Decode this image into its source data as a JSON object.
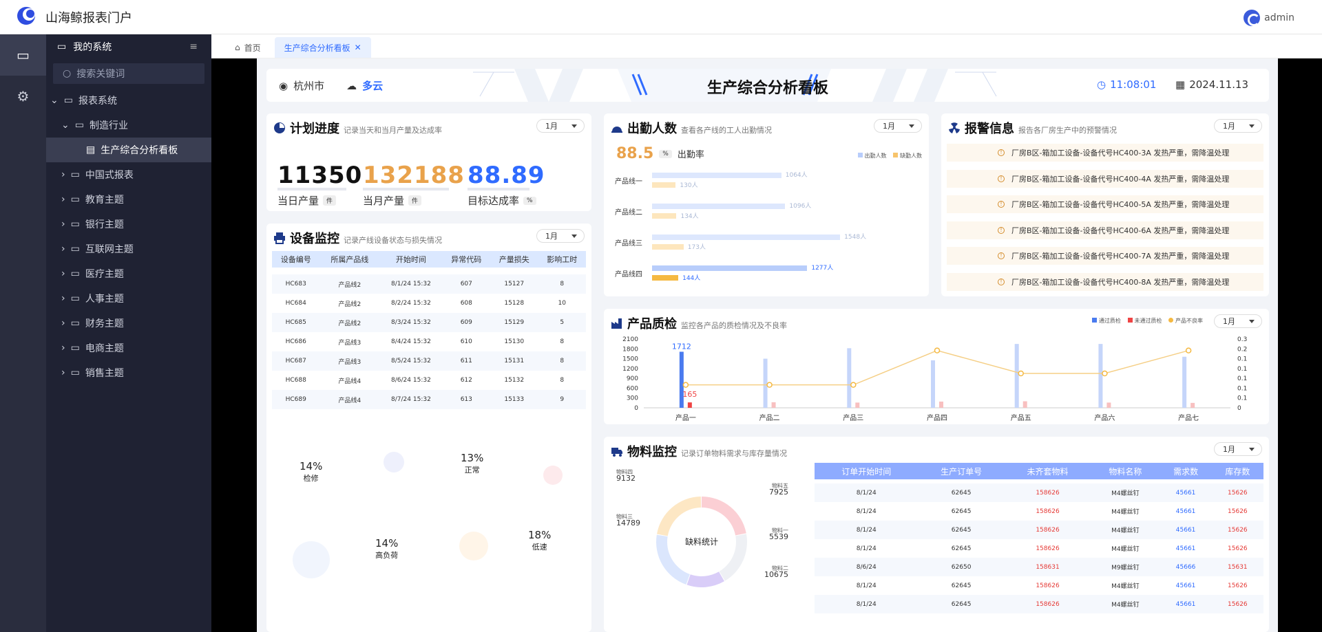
{
  "app": {
    "title": "山海鲸报表门户",
    "user": "admin"
  },
  "sidebar": {
    "header": "我的系统",
    "search_placeholder": "搜索关键词",
    "root": "报表系统",
    "group": "制造行业",
    "active": "生产综合分析看板",
    "items": [
      "中国式报表",
      "教育主题",
      "银行主题",
      "互联网主题",
      "医疗主题",
      "人事主题",
      "财务主题",
      "电商主题",
      "销售主题"
    ]
  },
  "tabs": {
    "home": "首页",
    "current": "生产综合分析看板"
  },
  "header": {
    "city": "杭州市",
    "weather": "多云",
    "title": "生产综合分析看板",
    "time": "11:08:01",
    "date": "2024.11.13"
  },
  "month": "1月",
  "plan": {
    "title": "计划进度",
    "desc": "记录当天和当月产量及达成率",
    "daily": "11350",
    "daily_label": "当日产量",
    "daily_unit": "件",
    "monthly": "132188",
    "monthly_label": "当月产量",
    "monthly_unit": "件",
    "rate": "88.89",
    "rate_label": "目标达成率",
    "rate_unit": "%"
  },
  "attendance": {
    "title": "出勤人数",
    "desc": "查看各产线的工人出勤情况",
    "rate": "88.5",
    "rate_unit": "%",
    "rate_label": "出勤率",
    "legend": [
      "出勤人数",
      "缺勤人数"
    ],
    "lines": [
      {
        "name": "产品线一",
        "present": 1064,
        "absent": 130,
        "present_label": "1064人",
        "absent_label": "130人"
      },
      {
        "name": "产品线二",
        "present": 1096,
        "absent": 134,
        "present_label": "1096人",
        "absent_label": "134人"
      },
      {
        "name": "产品线三",
        "present": 1548,
        "absent": 173,
        "present_label": "1548人",
        "absent_label": "173人"
      },
      {
        "name": "产品线四",
        "present": 1277,
        "absent": 144,
        "present_label": "1277人",
        "absent_label": "144人"
      }
    ]
  },
  "alerts": {
    "title": "报警信息",
    "desc": "报告各厂房生产中的预警情况",
    "items": [
      "厂房B区-箱加工设备-设备代号HC400-3A 发热严重，需降温处理",
      "厂房B区-箱加工设备-设备代号HC400-4A 发热严重，需降温处理",
      "厂房B区-箱加工设备-设备代号HC400-5A 发热严重，需降温处理",
      "厂房B区-箱加工设备-设备代号HC400-6A 发热严重，需降温处理",
      "厂房B区-箱加工设备-设备代号HC400-7A 发热严重，需降温处理",
      "厂房B区-箱加工设备-设备代号HC400-8A 发热严重，需降温处理"
    ]
  },
  "device": {
    "title": "设备监控",
    "desc": "记录产线设备状态与损失情况",
    "columns": [
      "设备编号",
      "所属产品线",
      "开始时间",
      "异常代码",
      "产量损失",
      "影响工时"
    ],
    "rows": [
      [
        "HC683",
        "产品线2",
        "8/1/24 15:32",
        "607",
        "15127",
        "8"
      ],
      [
        "HC684",
        "产品线2",
        "8/2/24 15:32",
        "608",
        "15128",
        "10"
      ],
      [
        "HC685",
        "产品线2",
        "8/3/24 15:32",
        "609",
        "15129",
        "5"
      ],
      [
        "HC686",
        "产品线3",
        "8/4/24 15:32",
        "610",
        "15130",
        "8"
      ],
      [
        "HC687",
        "产品线3",
        "8/5/24 15:32",
        "611",
        "15131",
        "8"
      ],
      [
        "HC688",
        "产品线4",
        "8/6/24 15:32",
        "612",
        "15132",
        "8"
      ],
      [
        "HC689",
        "产品线4",
        "8/7/24 15:32",
        "613",
        "15133",
        "9"
      ]
    ],
    "status": [
      {
        "pct": "14%",
        "label": "检修"
      },
      {
        "pct": "13%",
        "label": "正常"
      },
      {
        "pct": "14%",
        "label": "高负荷"
      },
      {
        "pct": "18%",
        "label": "低速"
      }
    ]
  },
  "quality": {
    "title": "产品质检",
    "desc": "监控各产品的质检情况及不良率",
    "legend": [
      "通过质检",
      "未通过质检",
      "产品不良率"
    ],
    "annotations": [
      "1712",
      "165"
    ],
    "chart_data": {
      "type": "bar",
      "categories": [
        "产品一",
        "产品二",
        "产品三",
        "产品四",
        "产品五",
        "产品六",
        "产品七"
      ],
      "series": [
        {
          "name": "通过质检",
          "values": [
            1712,
            1500,
            1820,
            1450,
            1950,
            1950,
            1560
          ]
        },
        {
          "name": "未通过质检",
          "values": [
            165,
            170,
            160,
            190,
            200,
            160,
            150
          ]
        },
        {
          "name": "产品不良率",
          "values": [
            0.1,
            0.1,
            0.1,
            0.25,
            0.15,
            0.15,
            0.25
          ]
        }
      ],
      "y_ticks": [
        "2100",
        "1800",
        "1500",
        "1200",
        "900",
        "600",
        "300",
        "0"
      ],
      "y2_ticks": [
        "0.3",
        "0.2",
        "0.1",
        "0.1",
        "0.1",
        "0.1",
        "0.1",
        "0"
      ],
      "ylim": [
        0,
        2100
      ],
      "y2lim": [
        0,
        0.3
      ]
    }
  },
  "material": {
    "title": "物料监控",
    "desc": "记录订单物料需求与库存量情况",
    "center": "缺料统计",
    "donut": [
      {
        "name": "物料四",
        "value": "9132"
      },
      {
        "name": "物料五",
        "value": "7925"
      },
      {
        "name": "物料三",
        "value": "14789"
      },
      {
        "name": "物料一",
        "value": "5539"
      },
      {
        "name": "物料二",
        "value": "10675"
      }
    ],
    "columns": [
      "订单开始时间",
      "生产订单号",
      "未齐套物料",
      "物料名称",
      "需求数",
      "库存数"
    ],
    "rows": [
      [
        "8/1/24",
        "62645",
        "158626",
        "M4螺丝钉",
        "45661",
        "15626"
      ],
      [
        "8/1/24",
        "62645",
        "158626",
        "M4螺丝钉",
        "45661",
        "15626"
      ],
      [
        "8/1/24",
        "62645",
        "158626",
        "M4螺丝钉",
        "45661",
        "15626"
      ],
      [
        "8/1/24",
        "62645",
        "158626",
        "M4螺丝钉",
        "45661",
        "15626"
      ],
      [
        "8/6/24",
        "62650",
        "158631",
        "M9螺丝钉",
        "45666",
        "15631"
      ],
      [
        "8/1/24",
        "62645",
        "158626",
        "M4螺丝钉",
        "45661",
        "15626"
      ],
      [
        "8/1/24",
        "62645",
        "158626",
        "M4螺丝钉",
        "45661",
        "15626"
      ]
    ]
  }
}
